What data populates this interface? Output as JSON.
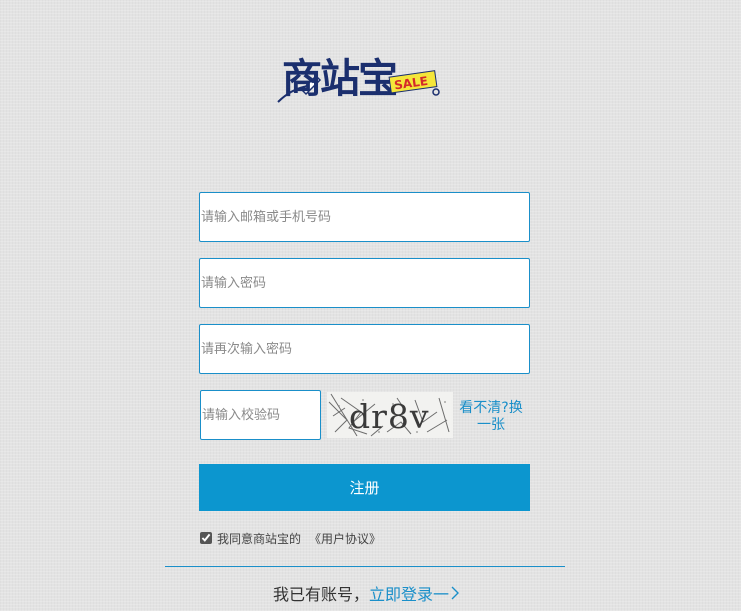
{
  "logo": {
    "text": "商站宝",
    "badge": "SALE"
  },
  "form": {
    "email_placeholder": "请输入邮箱或手机号码",
    "password_placeholder": "请输入密码",
    "confirm_password_placeholder": "请再次输入密码",
    "captcha_placeholder": "请输入校验码",
    "captcha_text": "dr8v",
    "refresh_label": "看不清?换一张",
    "register_label": "注册",
    "agree_checked": true,
    "agree_text": "我同意商站宝的",
    "agreement_link": "《用户协议》"
  },
  "footer": {
    "has_account": "我已有账号，",
    "login_link": "立即登录一"
  },
  "colors": {
    "accent": "#1a8fc9",
    "button": "#0c96cf",
    "logo_navy": "#1b2f6e",
    "background": "#e3e3e3"
  }
}
